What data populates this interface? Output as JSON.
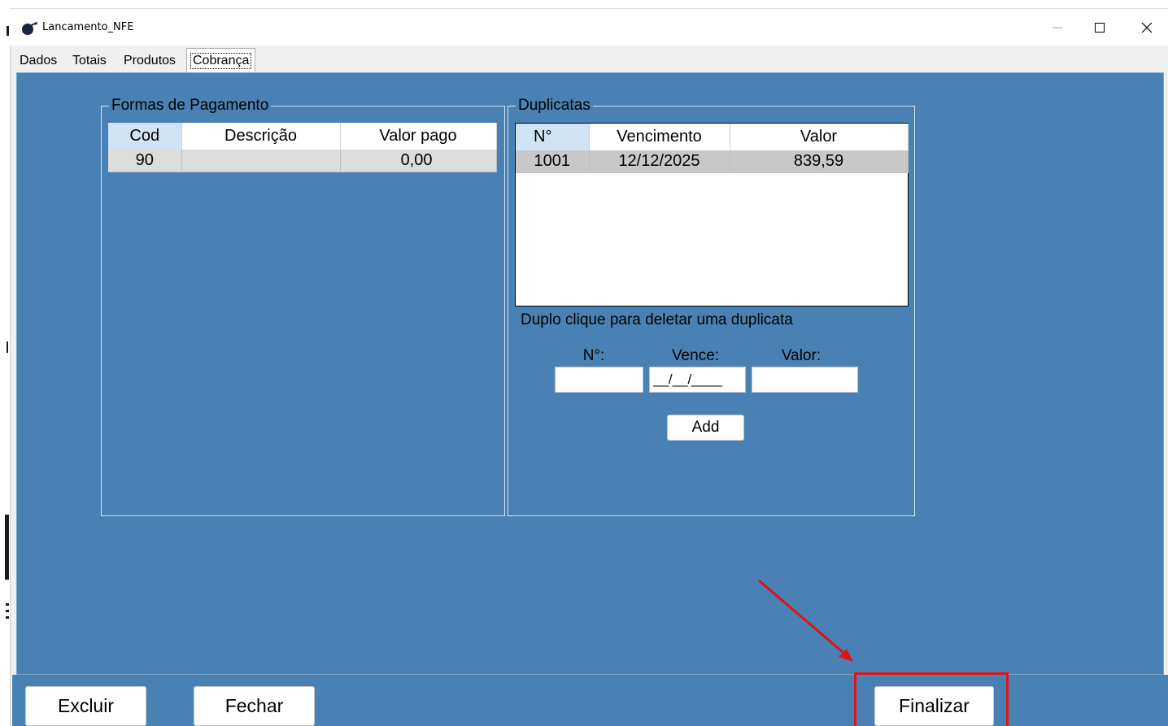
{
  "window": {
    "title": "Lancamento_NFE",
    "minimize_icon": "minimize-icon",
    "maximize_icon": "maximize-icon",
    "close_icon": "close-icon"
  },
  "tabs": [
    {
      "label": "Dados"
    },
    {
      "label": "Totais"
    },
    {
      "label": "Produtos"
    },
    {
      "label": "Cobrança",
      "selected": true
    }
  ],
  "formas_pagamento": {
    "title": "Formas de Pagamento",
    "columns": [
      "Cod",
      "Descrição",
      "Valor pago"
    ],
    "rows": [
      {
        "cod": "90",
        "descricao": "",
        "valor_pago": "0,00"
      }
    ]
  },
  "duplicatas": {
    "title": "Duplicatas",
    "columns": [
      "N°",
      "Vencimento",
      "Valor"
    ],
    "rows": [
      {
        "n": "1001",
        "vencimento": "12/12/2025",
        "valor": "839,59"
      }
    ],
    "hint": "Duplo clique para deletar uma duplicata",
    "form": {
      "n_label": "N°:",
      "n_value": "",
      "vence_label": "Vence:",
      "vence_value": "__/__/____",
      "valor_label": "Valor:",
      "valor_value": "",
      "add_label": "Add"
    }
  },
  "footer": {
    "excluir_label": "Excluir",
    "fechar_label": "Fechar",
    "finalizar_label": "Finalizar"
  },
  "annotation": {
    "color": "#e11414"
  },
  "colors": {
    "panel": "#4a81b4",
    "header_selected": "#cfe3f5"
  }
}
